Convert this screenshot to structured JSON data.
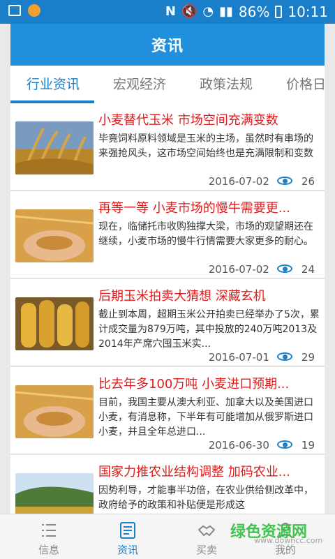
{
  "status_bar": {
    "battery": "86%",
    "time": "10:11"
  },
  "header": {
    "title": "资讯"
  },
  "tabs": [
    {
      "label": "行业资讯",
      "active": true
    },
    {
      "label": "宏观经济",
      "active": false
    },
    {
      "label": "政策法规",
      "active": false
    },
    {
      "label": "价格日",
      "active": false
    }
  ],
  "news": [
    {
      "title": "小麦替代玉米 市场空间充满变数",
      "summary": "毕竟饲料原料领域是玉米的主场，虽然时有串场的来强抢风头，这市场空间始终也是充满限制和变数",
      "date": "2016-07-02",
      "views": "26",
      "image": "wheat-field"
    },
    {
      "title": "再等一等 小麦市场的慢牛需要更...",
      "summary": "现在，临储托市收购独撑大梁，市场的观望期还在继续，小麦市场的慢牛行情需要大家更多的耐心。",
      "date": "2016-07-02",
      "views": "24",
      "image": "wheat-in-hands"
    },
    {
      "title": "后期玉米拍卖大猜想 深藏玄机",
      "summary": "截止到本周，超期玉米公开拍卖已经举办了5次，累计成交量为879万吨，其中投放的240万吨2013及2014年产席穴囤玉米实...",
      "date": "2016-07-01",
      "views": "29",
      "image": "corn-cobs"
    },
    {
      "title": "比去年多100万吨 小麦进口预期...",
      "summary": "目前，我国主要从澳大利亚、加拿大以及美国进口小麦，有消息称，下半年有可能增加从俄罗斯进口小麦，并且全年总进口...",
      "date": "2016-06-30",
      "views": "19",
      "image": "wheat-in-hands"
    },
    {
      "title": "国家力推农业结构调整 加码农业...",
      "summary": "因势利导，才能事半功倍，在农业供给侧改革中，政府给予的政策和补贴便是形成这",
      "date": "",
      "views": "",
      "image": "farm-landscape"
    }
  ],
  "bottom_nav": [
    {
      "label": "信息",
      "icon": "list-icon",
      "active": false
    },
    {
      "label": "资讯",
      "icon": "document-icon",
      "active": true
    },
    {
      "label": "买卖",
      "icon": "handshake-icon",
      "active": false
    },
    {
      "label": "我的",
      "icon": "user-icon",
      "active": false
    }
  ],
  "watermark": {
    "text": "绿色资源网",
    "sub": "www.downcc.com"
  }
}
